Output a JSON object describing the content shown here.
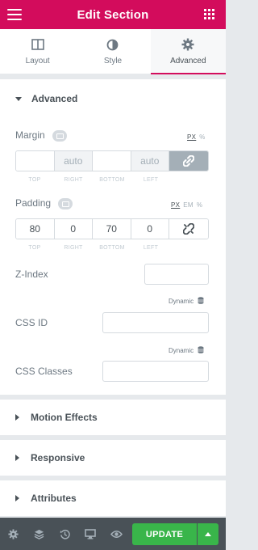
{
  "header": {
    "title": "Edit Section"
  },
  "tabs": [
    {
      "label": "Layout"
    },
    {
      "label": "Style"
    },
    {
      "label": "Advanced"
    }
  ],
  "advanced": {
    "title": "Advanced",
    "margin": {
      "label": "Margin",
      "units": [
        "PX",
        "%"
      ],
      "selected_unit": "PX",
      "top": "",
      "right": "auto",
      "bottom": "",
      "left": "auto",
      "right_placeholder": "auto",
      "left_placeholder": "auto",
      "linked": true
    },
    "padding": {
      "label": "Padding",
      "units": [
        "PX",
        "EM",
        "%"
      ],
      "selected_unit": "PX",
      "top": "80",
      "right": "0",
      "bottom": "70",
      "left": "0",
      "linked": false
    },
    "captions": {
      "top": "TOP",
      "right": "RIGHT",
      "bottom": "BOTTOM",
      "left": "LEFT"
    },
    "z_index": {
      "label": "Z-Index",
      "value": ""
    },
    "css_id": {
      "label": "CSS ID",
      "value": "",
      "dynamic_label": "Dynamic"
    },
    "css_classes": {
      "label": "CSS Classes",
      "value": "",
      "dynamic_label": "Dynamic"
    }
  },
  "sections": [
    {
      "title": "Motion Effects"
    },
    {
      "title": "Responsive"
    },
    {
      "title": "Attributes"
    }
  ],
  "footer": {
    "update_label": "UPDATE"
  },
  "colors": {
    "brand": "#d30c5c",
    "update": "#39b54a",
    "footer": "#495157"
  }
}
